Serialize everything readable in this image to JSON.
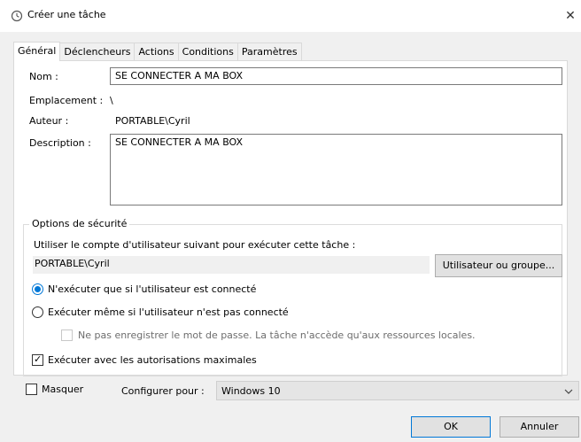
{
  "window": {
    "title": "Créer une tâche",
    "close_glyph": "✕"
  },
  "tabs": [
    {
      "label": "Général"
    },
    {
      "label": "Déclencheurs"
    },
    {
      "label": "Actions"
    },
    {
      "label": "Conditions"
    },
    {
      "label": "Paramètres"
    }
  ],
  "general": {
    "name_label": "Nom :",
    "name_value": "SE CONNECTER A MA BOX",
    "location_label": "Emplacement :",
    "location_value": "\\",
    "author_label": "Auteur :",
    "author_value": "PORTABLE\\Cyril",
    "description_label": "Description :",
    "description_value": "SE CONNECTER A MA BOX"
  },
  "security": {
    "group_title": "Options de sécurité",
    "account_prompt": "Utiliser le compte d'utilisateur suivant pour exécuter cette tâche :",
    "account_value": "PORTABLE\\Cyril",
    "user_group_button": "Utilisateur ou groupe...",
    "radio_logged_on": "N'exécuter que si l'utilisateur est connecté",
    "radio_logged_on_checked": true,
    "radio_any": "Exécuter même si l'utilisateur n'est pas connecté",
    "radio_any_checked": false,
    "no_password": "Ne pas enregistrer le mot de passe. La tâche n'accède qu'aux ressources locales.",
    "no_password_checked": false,
    "highest_privileges": "Exécuter avec les autorisations maximales",
    "highest_privileges_checked": true
  },
  "footer": {
    "hidden_label": "Masquer",
    "hidden_checked": false,
    "configure_label": "Configurer pour :",
    "configure_value": "Windows 10",
    "ok_label": "OK",
    "cancel_label": "Annuler"
  },
  "icons": {
    "title_icon": "clock-icon",
    "dropdown_icon": "chevron-down-icon"
  },
  "colors": {
    "accent": "#0078d7",
    "dialog_bg": "#f0f0f0"
  }
}
